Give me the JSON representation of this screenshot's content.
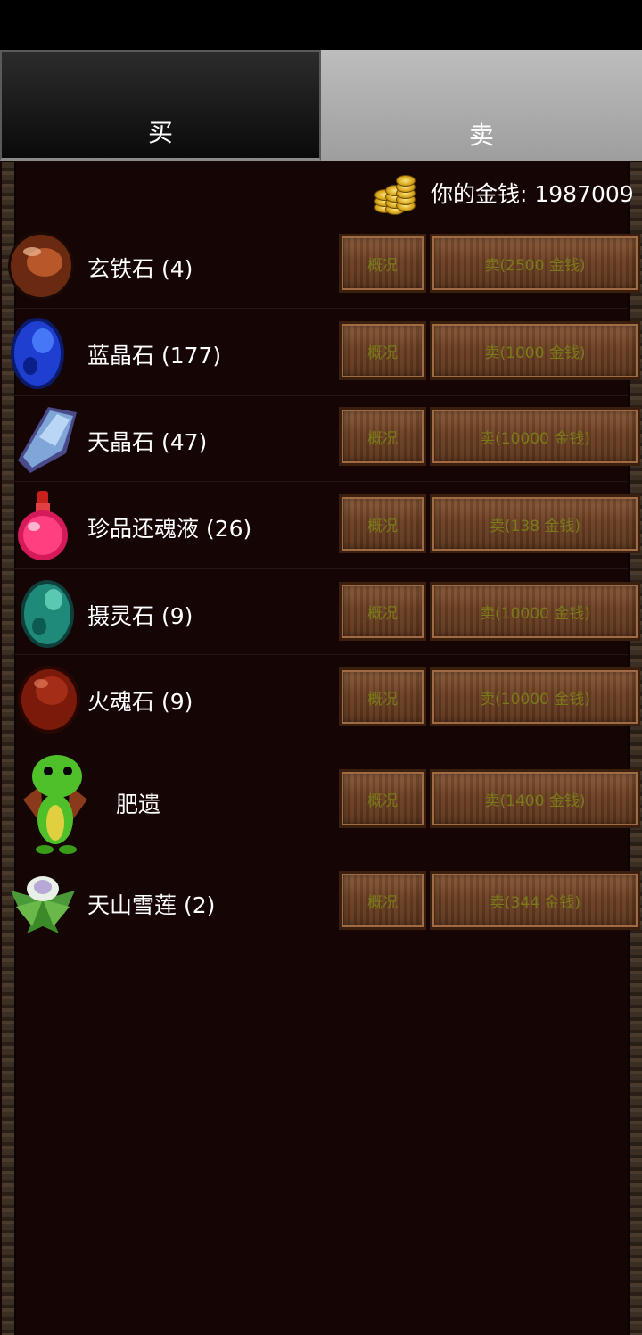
{
  "tabs": {
    "buy": "买",
    "sell": "卖"
  },
  "money": {
    "label": "你的金钱: 1987009"
  },
  "items": [
    {
      "name": "玄铁石 (4)",
      "detail": "概况",
      "sell": "卖(2500 金钱)"
    },
    {
      "name": "蓝晶石 (177)",
      "detail": "概况",
      "sell": "卖(1000 金钱)"
    },
    {
      "name": "天晶石 (47)",
      "detail": "概况",
      "sell": "卖(10000 金钱)"
    },
    {
      "name": "珍品还魂液 (26)",
      "detail": "概况",
      "sell": "卖(138 金钱)"
    },
    {
      "name": "摄灵石 (9)",
      "detail": "概况",
      "sell": "卖(10000 金钱)"
    },
    {
      "name": "火魂石 (9)",
      "detail": "概况",
      "sell": "卖(10000 金钱)"
    },
    {
      "name": "肥遗",
      "detail": "概况",
      "sell": "卖(1400 金钱)"
    },
    {
      "name": "天山雪莲 (2)",
      "detail": "概况",
      "sell": "卖(344 金钱)"
    }
  ],
  "icons": [
    "dark-stone-icon",
    "blue-crystal-icon",
    "sky-crystal-icon",
    "red-potion-icon",
    "green-gem-icon",
    "fire-gem-icon",
    "green-dragon-pet-icon",
    "snow-lotus-icon"
  ]
}
